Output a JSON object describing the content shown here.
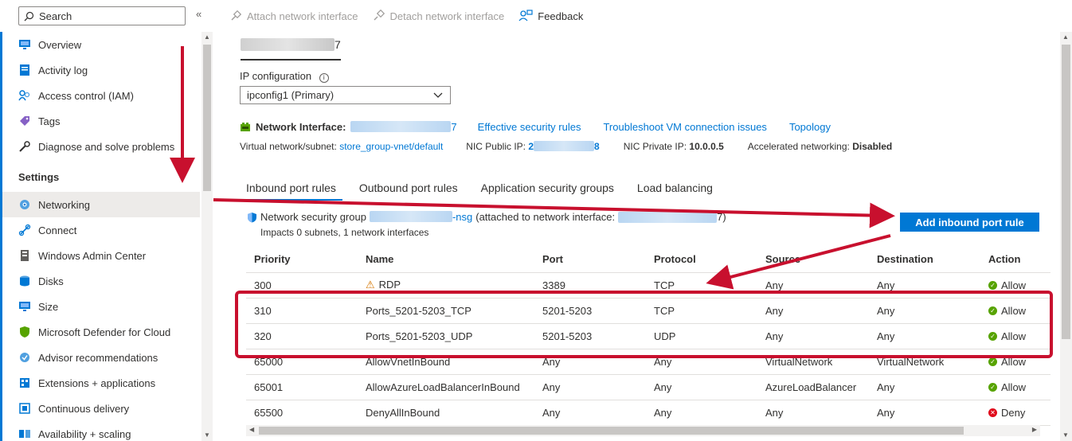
{
  "sidebar": {
    "search_placeholder": "Search",
    "collapse_glyph": "«",
    "items": [
      {
        "label": "Overview",
        "icon": "overview-icon"
      },
      {
        "label": "Activity log",
        "icon": "activity-log-icon"
      },
      {
        "label": "Access control (IAM)",
        "icon": "iam-icon"
      },
      {
        "label": "Tags",
        "icon": "tag-icon"
      },
      {
        "label": "Diagnose and solve problems",
        "icon": "wrench-icon"
      }
    ],
    "section_settings": "Settings",
    "settings_items": [
      {
        "label": "Networking",
        "icon": "networking-icon"
      },
      {
        "label": "Connect",
        "icon": "connect-icon"
      },
      {
        "label": "Windows Admin Center",
        "icon": "windows-admin-center-icon"
      },
      {
        "label": "Disks",
        "icon": "disk-icon"
      },
      {
        "label": "Size",
        "icon": "size-icon"
      },
      {
        "label": "Microsoft Defender for Cloud",
        "icon": "defender-icon"
      },
      {
        "label": "Advisor recommendations",
        "icon": "advisor-icon"
      },
      {
        "label": "Extensions + applications",
        "icon": "extensions-icon"
      },
      {
        "label": "Continuous delivery",
        "icon": "continuous-delivery-icon"
      },
      {
        "label": "Availability + scaling",
        "icon": "availability-icon"
      }
    ]
  },
  "toolbar": {
    "attach": "Attach network interface",
    "detach": "Detach network interface",
    "feedback": "Feedback"
  },
  "main": {
    "vm_name_suffix": "7",
    "ip_config_label": "IP configuration",
    "ip_config_value": "ipconfig1 (Primary)",
    "nic_label": "Network Interface:",
    "nic_suffix": "7",
    "effective_rules": "Effective security rules",
    "troubleshoot": "Troubleshoot VM connection issues",
    "topology": "Topology",
    "vnet_label": "Virtual network/subnet:",
    "vnet_value": "store_group-vnet/default",
    "public_ip_label": "NIC Public IP:",
    "public_ip_prefix": "2",
    "public_ip_suffix": "8",
    "private_ip_label": "NIC Private IP:",
    "private_ip_value": "10.0.0.5",
    "accel_label": "Accelerated networking:",
    "accel_value": "Disabled",
    "tabs": [
      "Inbound port rules",
      "Outbound port rules",
      "Application security groups",
      "Load balancing"
    ],
    "nsg_prefix": "Network security group",
    "nsg_suffix": "-nsg",
    "nsg_attached": "(attached to network interface:",
    "nsg_close": "7)",
    "nsg_impacts": "Impacts 0 subnets, 1 network interfaces",
    "add_rule_button": "Add inbound port rule"
  },
  "table": {
    "headers": [
      "Priority",
      "Name",
      "Port",
      "Protocol",
      "Source",
      "Destination",
      "Action"
    ],
    "rows": [
      {
        "priority": "300",
        "name": "RDP",
        "warn": true,
        "port": "3389",
        "protocol": "TCP",
        "source": "Any",
        "destination": "Any",
        "action": "Allow"
      },
      {
        "priority": "310",
        "name": "Ports_5201-5203_TCP",
        "warn": false,
        "port": "5201-5203",
        "protocol": "TCP",
        "source": "Any",
        "destination": "Any",
        "action": "Allow"
      },
      {
        "priority": "320",
        "name": "Ports_5201-5203_UDP",
        "warn": false,
        "port": "5201-5203",
        "protocol": "UDP",
        "source": "Any",
        "destination": "Any",
        "action": "Allow"
      },
      {
        "priority": "65000",
        "name": "AllowVnetInBound",
        "warn": false,
        "port": "Any",
        "protocol": "Any",
        "source": "VirtualNetwork",
        "destination": "VirtualNetwork",
        "action": "Allow"
      },
      {
        "priority": "65001",
        "name": "AllowAzureLoadBalancerInBound",
        "warn": false,
        "port": "Any",
        "protocol": "Any",
        "source": "AzureLoadBalancer",
        "destination": "Any",
        "action": "Allow"
      },
      {
        "priority": "65500",
        "name": "DenyAllInBound",
        "warn": false,
        "port": "Any",
        "protocol": "Any",
        "source": "Any",
        "destination": "Any",
        "action": "Deny"
      }
    ]
  },
  "colors": {
    "accent": "#0078d4",
    "annotation": "#c8102e",
    "allow": "#57a300",
    "deny": "#e00b1c"
  }
}
